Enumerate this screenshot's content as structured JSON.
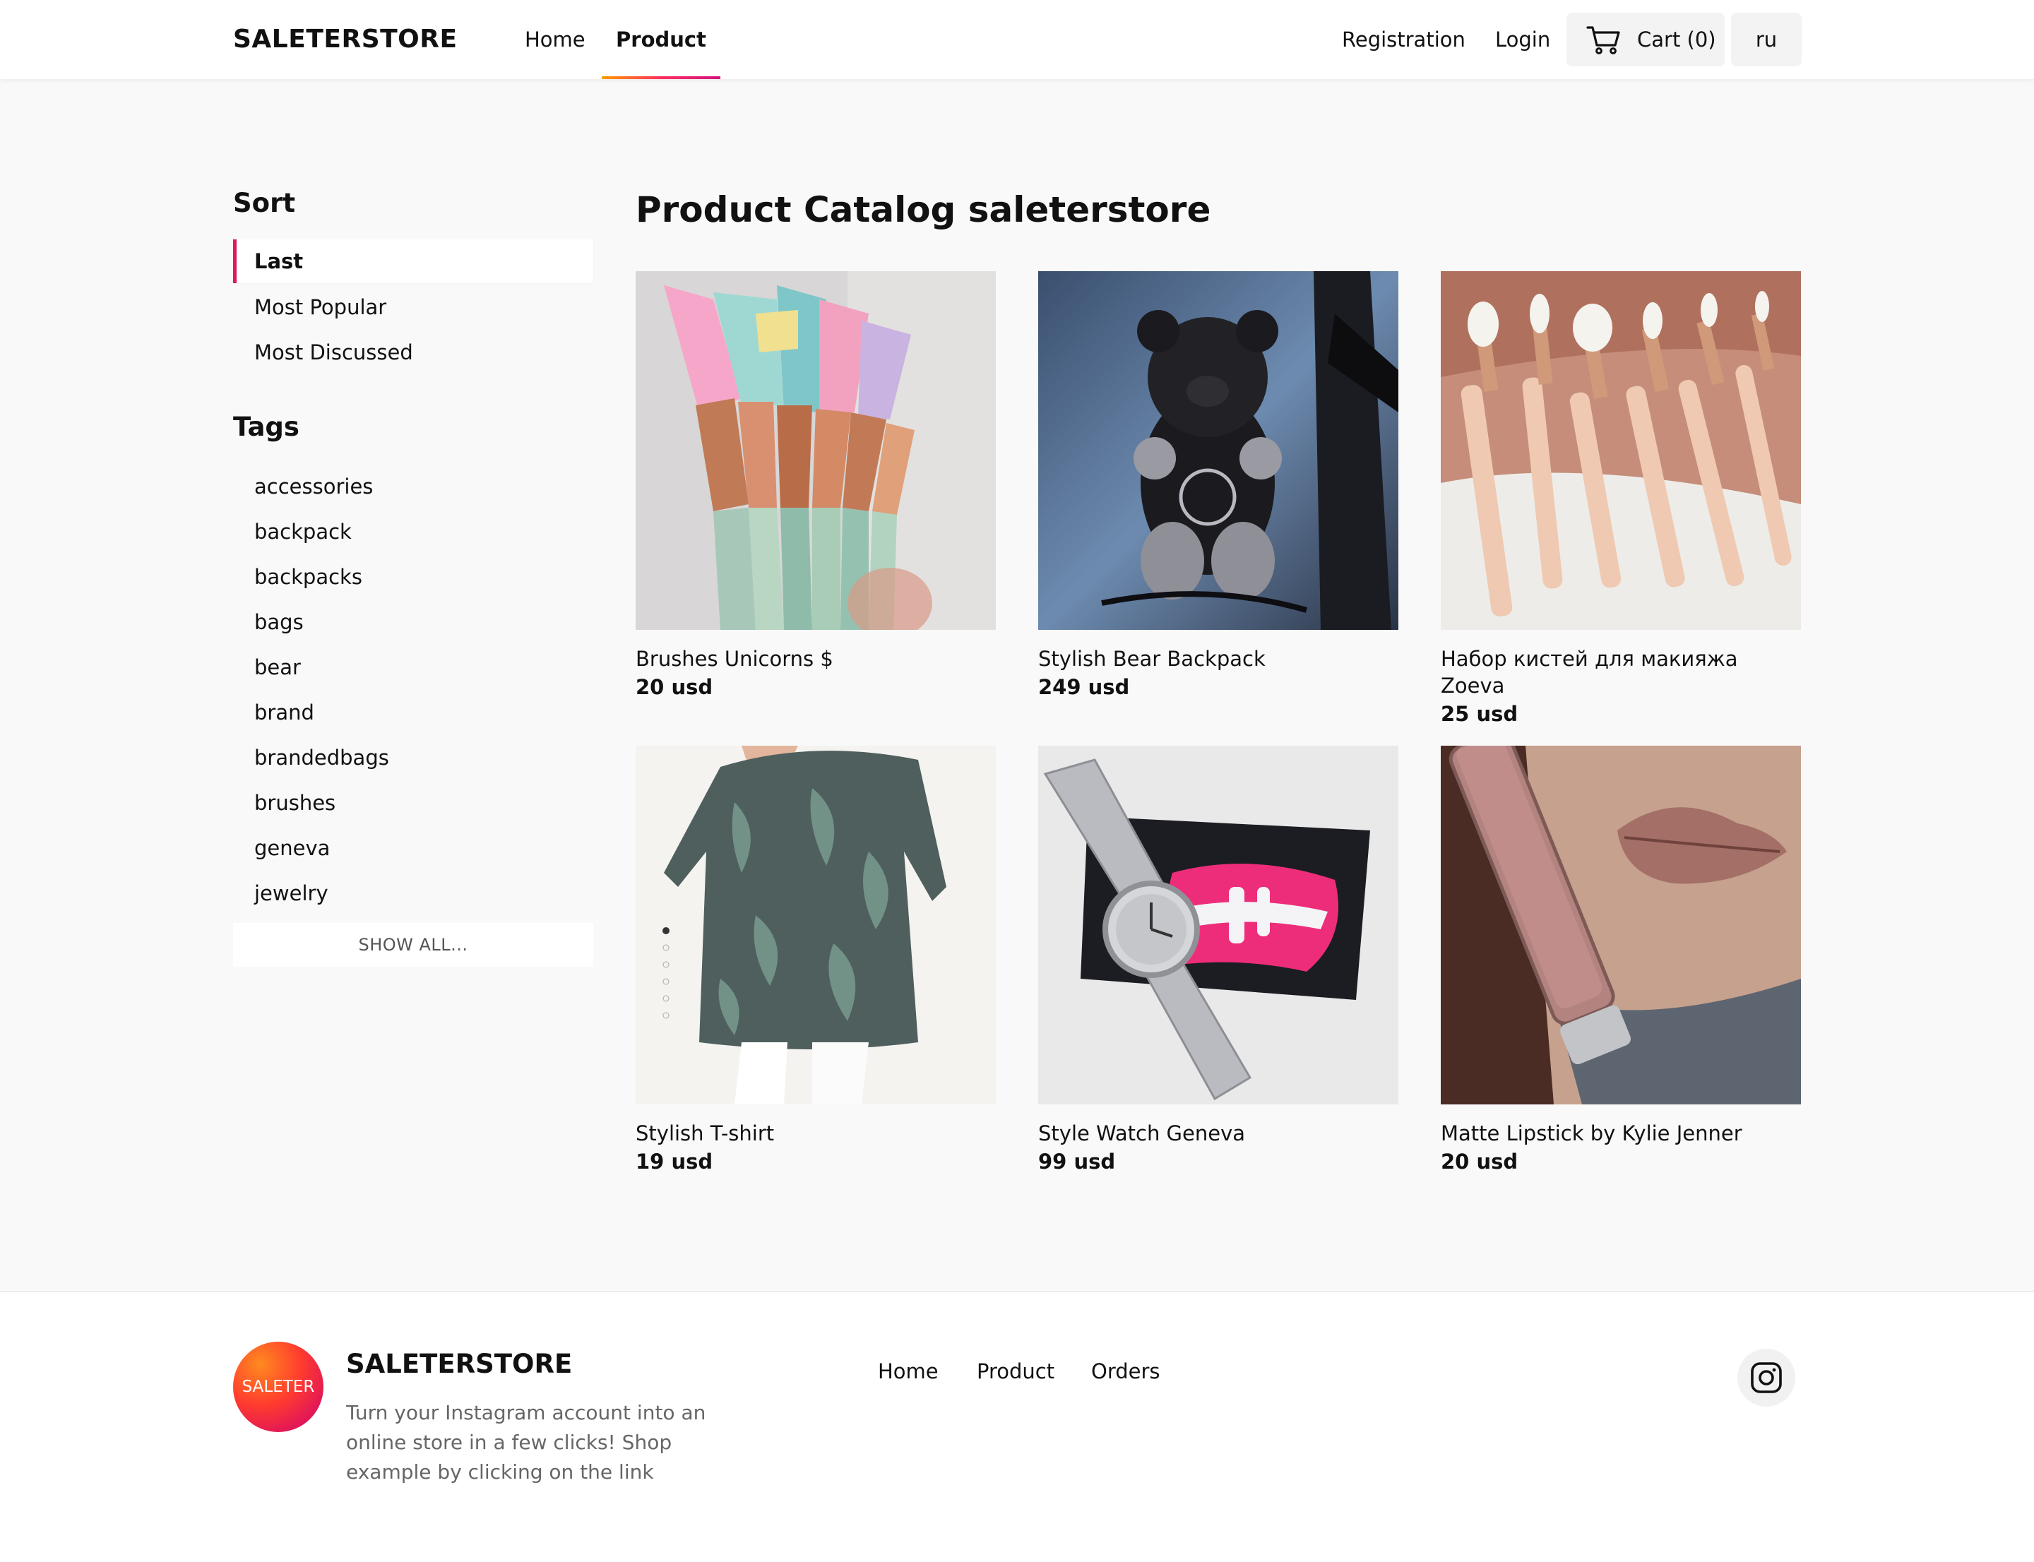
{
  "header": {
    "logo": "SALETERSTORE",
    "nav": {
      "home": "Home",
      "product": "Product"
    },
    "registration": "Registration",
    "login": "Login",
    "cart": "Cart (0)",
    "language": "ru"
  },
  "sidebar": {
    "sort_heading": "Sort",
    "sort_items": [
      "Last",
      "Most Popular",
      "Most Discussed"
    ],
    "tags_heading": "Tags",
    "tags": [
      "accessories",
      "backpack",
      "backpacks",
      "bags",
      "bear",
      "brand",
      "brandedbags",
      "brushes",
      "geneva",
      "jewelry"
    ],
    "show_all": "SHOW ALL..."
  },
  "main": {
    "title": "Product Catalog saleterstore",
    "products": [
      {
        "name": "Brushes Unicorns $",
        "price": "20 usd"
      },
      {
        "name": "Stylish Bear Backpack",
        "price": "249 usd"
      },
      {
        "name": "Набор кистей для макияжа Zoeva",
        "price": "25 usd"
      },
      {
        "name": "Stylish T-shirt",
        "price": "19 usd"
      },
      {
        "name": "Style Watch Geneva",
        "price": "99 usd"
      },
      {
        "name": "Matte Lipstick by Kylie Jenner",
        "price": "20 usd"
      }
    ]
  },
  "footer": {
    "badge": "SALETER",
    "brand": "SALETERSTORE",
    "description": "Turn your Instagram account into an online store in a few clicks! Shop example by clicking on the link",
    "links": {
      "home": "Home",
      "product": "Product",
      "orders": "Orders"
    }
  },
  "icons": {
    "cart": "cart-icon",
    "instagram": "instagram-icon"
  },
  "colors": {
    "accent": "#e0195a",
    "accent_orange": "#ff9d00"
  }
}
